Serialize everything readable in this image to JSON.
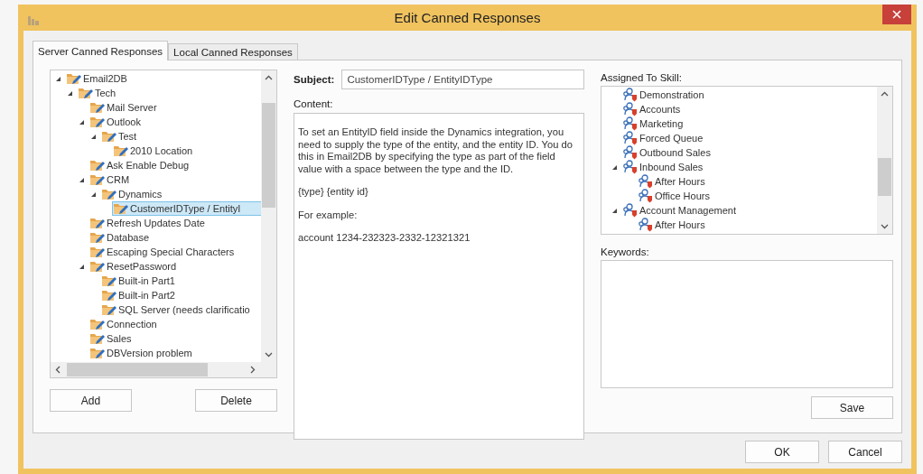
{
  "window": {
    "title": "Edit Canned Responses"
  },
  "tabs": [
    {
      "label": "Server Canned Responses",
      "selected": true
    },
    {
      "label": "Local Canned Responses",
      "selected": false
    }
  ],
  "responses_tree": [
    {
      "label": "Email2DB",
      "expanded": true,
      "selected": false,
      "children": [
        {
          "label": "Tech",
          "expanded": true,
          "selected": false,
          "children": [
            {
              "label": "Mail Server",
              "selected": false
            },
            {
              "label": "Outlook",
              "expanded": true,
              "selected": false,
              "children": [
                {
                  "label": "Test",
                  "expanded": true,
                  "selected": false,
                  "children": [
                    {
                      "label": "2010 Location",
                      "selected": false
                    }
                  ]
                }
              ]
            },
            {
              "label": "Ask Enable Debug",
              "selected": false
            },
            {
              "label": "CRM",
              "expanded": true,
              "selected": false,
              "children": [
                {
                  "label": "Dynamics",
                  "expanded": true,
                  "selected": false,
                  "children": [
                    {
                      "label": "CustomerIDType / EntityI",
                      "selected": true
                    }
                  ]
                }
              ]
            },
            {
              "label": "Refresh Updates Date",
              "selected": false
            },
            {
              "label": "Database",
              "selected": false
            },
            {
              "label": "Escaping Special Characters",
              "selected": false
            },
            {
              "label": "ResetPassword",
              "expanded": true,
              "selected": false,
              "children": [
                {
                  "label": "Built-in Part1",
                  "selected": false
                },
                {
                  "label": "Built-in Part2",
                  "selected": false
                },
                {
                  "label": "SQL Server (needs clarificatio",
                  "selected": false
                }
              ]
            },
            {
              "label": "Connection",
              "selected": false
            },
            {
              "label": "Sales",
              "selected": false
            },
            {
              "label": "DBVersion problem",
              "selected": false
            }
          ]
        }
      ]
    }
  ],
  "tree_buttons": [
    "Add",
    "Delete"
  ],
  "subject": {
    "label": "Subject:",
    "value": "CustomerIDType / EntityIDType"
  },
  "content": {
    "label": "Content:",
    "paragraphs": [
      "To set an EntityID field inside the Dynamics integration, you need to supply the type of the entity, and the entity ID.  You do this in Email2DB by specifying the type as part of the field value with a space between the type and the ID.",
      "{type} {entity id}",
      "For example:",
      "account 1234-232323-2332-12321321"
    ]
  },
  "skills": {
    "label": "Assigned To Skill:",
    "items": [
      {
        "label": "Demonstration",
        "selected": false
      },
      {
        "label": "Accounts",
        "selected": false
      },
      {
        "label": "Marketing",
        "selected": false
      },
      {
        "label": "Forced Queue",
        "selected": false
      },
      {
        "label": "Outbound Sales",
        "selected": false
      },
      {
        "label": "Inbound Sales",
        "expanded": true,
        "selected": false,
        "children": [
          {
            "label": "After Hours",
            "selected": false
          },
          {
            "label": "Office Hours",
            "selected": false
          }
        ]
      },
      {
        "label": "Account Management",
        "expanded": true,
        "selected": false,
        "children": [
          {
            "label": "After Hours",
            "selected": false
          }
        ]
      }
    ]
  },
  "keywords": {
    "label": "Keywords:"
  },
  "save_button": "Save",
  "dialog_buttons": [
    "OK",
    "Cancel"
  ]
}
